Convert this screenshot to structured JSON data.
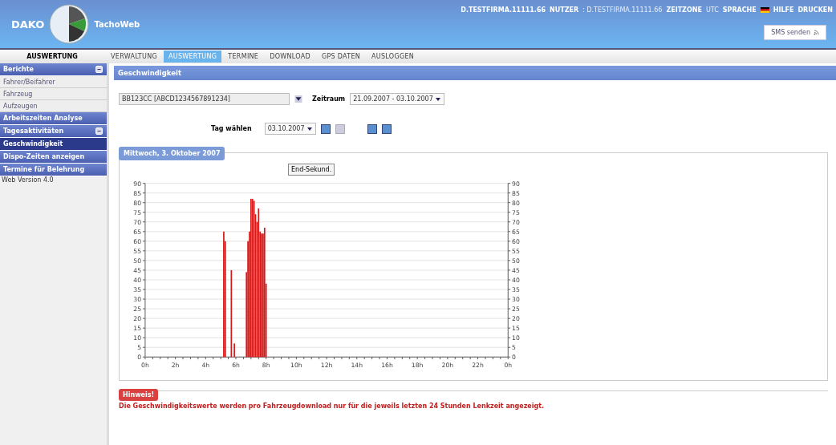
{
  "header": {
    "logo_text": "DAKO",
    "app_name": "TachoWeb",
    "company": "D.TESTFIRMA.11111.66",
    "user_label": "NUTZER",
    "user": ": D.TESTFIRMA.11111.66",
    "timezone_label": "ZEITZONE",
    "timezone": "UTC",
    "language_label": "SPRACHE",
    "help": "HILFE",
    "print": "DRUCKEN",
    "sms_button": "SMS senden"
  },
  "section_title": "AUSWERTUNG",
  "tabs": [
    {
      "label": "VERWALTUNG",
      "selected": false
    },
    {
      "label": "AUSWERTUNG",
      "selected": true
    },
    {
      "label": "TERMINE",
      "selected": false
    },
    {
      "label": "DOWNLOAD",
      "selected": false
    },
    {
      "label": "GPS DATEN",
      "selected": false
    },
    {
      "label": "AUSLOGGEN",
      "selected": false
    }
  ],
  "sidebar": {
    "items": [
      {
        "label": "Berichte",
        "kind": "group",
        "selected": false
      },
      {
        "label": "Fahrer/Beifahrer",
        "kind": "sub",
        "selected": false
      },
      {
        "label": "Fahrzeug",
        "kind": "sub",
        "selected": false
      },
      {
        "label": "Aufzeugen",
        "kind": "sub",
        "selected": false
      },
      {
        "label": "Arbeitszeiten Analyse",
        "kind": "item",
        "selected": false
      },
      {
        "label": "Tagesaktivitäten",
        "kind": "group",
        "selected": false
      },
      {
        "label": "Geschwindigkeit",
        "kind": "item",
        "selected": true
      },
      {
        "label": "Dispo-Zeiten anzeigen",
        "kind": "item",
        "selected": false
      },
      {
        "label": "Termine für Belehrung",
        "kind": "item",
        "selected": false
      }
    ],
    "version": "Web Version 4.0"
  },
  "page_title": "Geschwindigkeit",
  "vehicle_select": {
    "value": "BB123CC [ABCD1234567891234]"
  },
  "period": {
    "label": "Zeitraum",
    "value": "21.09.2007 - 03.10.2007"
  },
  "day": {
    "label": "Tag wählen",
    "value": "03.10.2007"
  },
  "chart_panel": {
    "title": "Mittwoch, 3. Oktober 2007",
    "button": "End-Sekund.",
    "end_label": "0h",
    "right_axis_labels": [
      "90",
      "85",
      "80",
      "75",
      "70",
      "65",
      "60",
      "55",
      "50",
      "45",
      "40",
      "35",
      "30",
      "25",
      "20",
      "15",
      "10",
      "5",
      "0"
    ],
    "chart_data": {
      "type": "bar",
      "grid": true,
      "x": [
        5.2,
        5.3,
        5.7,
        5.9,
        6.7,
        6.8,
        6.9,
        7.0,
        7.1,
        7.2,
        7.3,
        7.4,
        7.5,
        7.6,
        7.7,
        7.8,
        7.9,
        8.0
      ],
      "values": [
        65,
        60,
        45,
        7,
        44,
        60,
        65,
        82,
        82,
        81,
        74,
        70,
        77,
        65,
        64,
        64,
        67,
        38
      ],
      "xlim": [
        0,
        24
      ],
      "ylim": [
        0,
        90
      ],
      "xticks": [
        {
          "value": 0,
          "label": "0h"
        },
        {
          "value": 2,
          "label": "2h"
        },
        {
          "value": 4,
          "label": "4h"
        },
        {
          "value": 6,
          "label": "6h"
        },
        {
          "value": 8,
          "label": "8h"
        },
        {
          "value": 10,
          "label": "10h"
        },
        {
          "value": 12,
          "label": "12h"
        },
        {
          "value": 14,
          "label": "14h"
        },
        {
          "value": 16,
          "label": "16h"
        },
        {
          "value": 18,
          "label": "18h"
        },
        {
          "value": 20,
          "label": "20h"
        },
        {
          "value": 22,
          "label": "22h"
        }
      ],
      "yticks": [
        0,
        5,
        10,
        15,
        20,
        25,
        30,
        35,
        40,
        45,
        50,
        55,
        60,
        65,
        70,
        75,
        80,
        85,
        90
      ]
    }
  },
  "notice": {
    "title": "Hinweis!",
    "text": "Die Geschwindigkeitswerte werden pro Fahrzeugdownload nur für die jeweils letzten 24 Stunden Lenkzeit angezeigt."
  }
}
